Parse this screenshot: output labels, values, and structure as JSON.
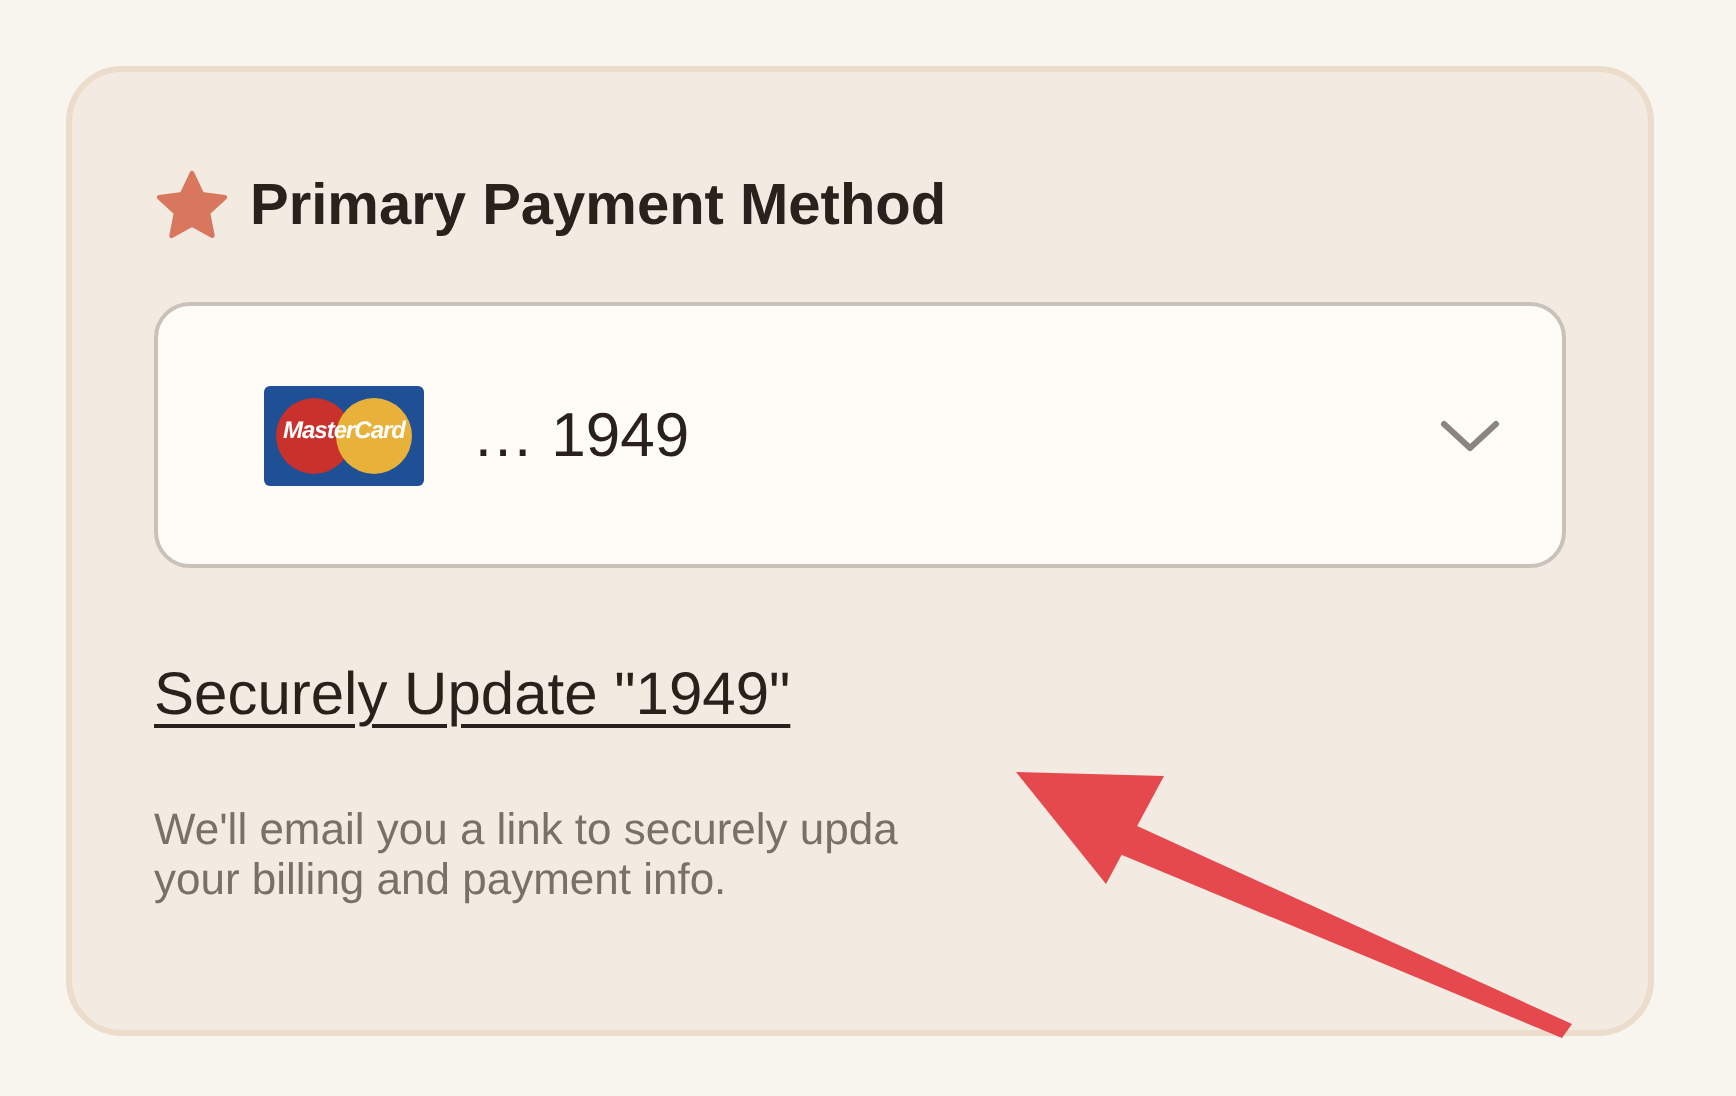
{
  "card": {
    "title": "Primary Payment Method",
    "selector": {
      "logo_text": "MasterCard",
      "value": "… 1949"
    },
    "link": "Securely Update \"1949\"",
    "hint_lines": [
      "We'll email you a link to securely upda",
      "your billing and payment info."
    ]
  }
}
